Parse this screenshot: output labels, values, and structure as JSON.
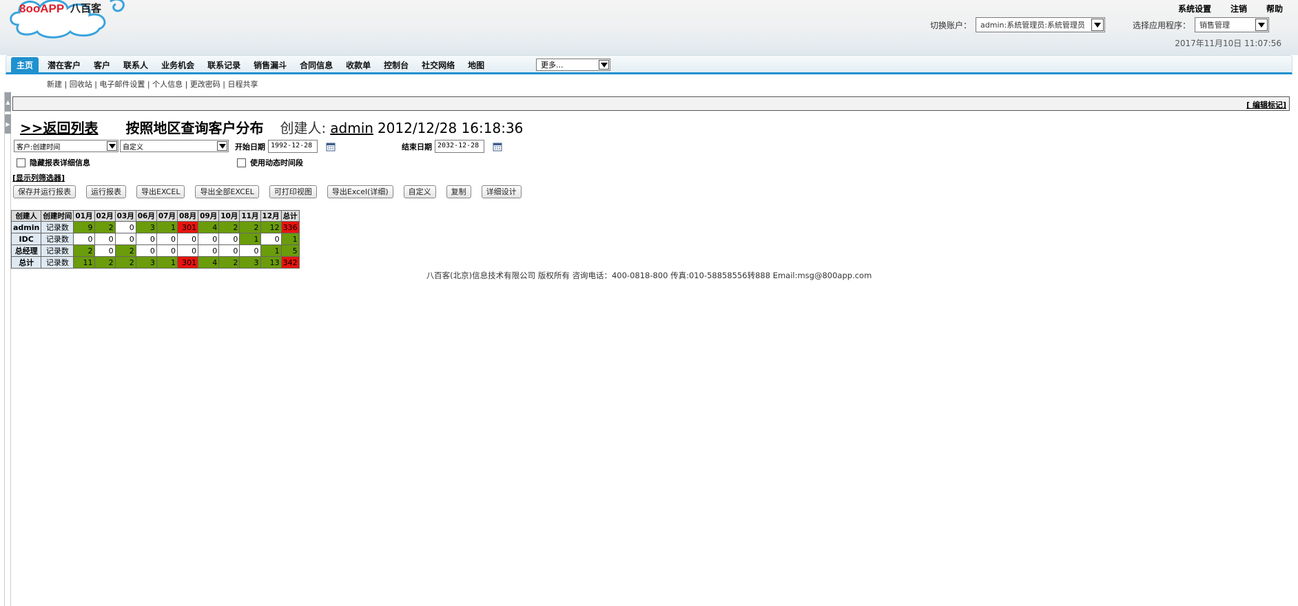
{
  "brand": {
    "logo_text_latin": "8ooAPP",
    "logo_text_cn": "八百客"
  },
  "top_links": [
    "系统设置",
    "注销",
    "帮助"
  ],
  "account": {
    "label": "切换账户：",
    "value": "admin:系統管理员:系統管理员"
  },
  "app": {
    "label": "选择应用程序：",
    "value": "销售管理"
  },
  "datetime": "2017年11月10日 11:07:56",
  "nav": {
    "items": [
      "主页",
      "潜在客户",
      "客户",
      "联系人",
      "业务机会",
      "联系记录",
      "销售漏斗",
      "合同信息",
      "收款单",
      "控制台",
      "社交网络",
      "地图"
    ],
    "active": "主页",
    "more": "更多..."
  },
  "subnav": [
    "新建",
    "回收站",
    "电子邮件设置",
    "个人信息",
    "更改密码",
    "日程共享"
  ],
  "mark_edit": "[ 编辑标记]",
  "report": {
    "back": ">>返回列表",
    "name": "按照地区查询客户分布",
    "creator_label": "创建人:",
    "creator": "admin",
    "created": "2012/12/28 16:18:36"
  },
  "filters": {
    "field": "客户:创建时间",
    "range": "自定义",
    "start_label": "开始日期",
    "start": "1992-12-28",
    "end_label": "结束日期",
    "end": "2032-12-28",
    "hide_detail": "隐藏报表详细信息",
    "dynamic": "使用动态时间段",
    "show_cols": "[显示列筛选器]"
  },
  "buttons": [
    "保存并运行报表",
    "运行报表",
    "导出EXCEL",
    "导出全部EXCEL",
    "可打印视图",
    "导出Excel(详细)",
    "自定义",
    "复制",
    "详细设计"
  ],
  "table": {
    "headers": [
      "创建人",
      "创建时间",
      "01月",
      "02月",
      "03月",
      "06月",
      "07月",
      "08月",
      "09月",
      "10月",
      "11月",
      "12月",
      "总计"
    ],
    "rows": [
      {
        "label": "admin",
        "sub": "记录数",
        "values": [
          9,
          2,
          0,
          3,
          1,
          301,
          4,
          2,
          2,
          12,
          336
        ]
      },
      {
        "label": "IDC",
        "sub": "记录数",
        "values": [
          0,
          0,
          0,
          0,
          0,
          0,
          0,
          0,
          1,
          0,
          1
        ]
      },
      {
        "label": "总经理",
        "sub": "记录数",
        "values": [
          2,
          0,
          2,
          0,
          0,
          0,
          0,
          0,
          0,
          1,
          5
        ]
      },
      {
        "label": "总计",
        "sub": "记录数",
        "values": [
          11,
          2,
          2,
          3,
          1,
          301,
          4,
          2,
          3,
          13,
          342
        ]
      }
    ],
    "colors": {
      "zero": "#ffffff",
      "low": "#6a9c0b",
      "high": "#e8140e"
    }
  },
  "footer": "八百客(北京)信息技术有限公司 版权所有 咨询电话：400-0818-800 传真:010-58858556转888 Email:msg@800app.com"
}
